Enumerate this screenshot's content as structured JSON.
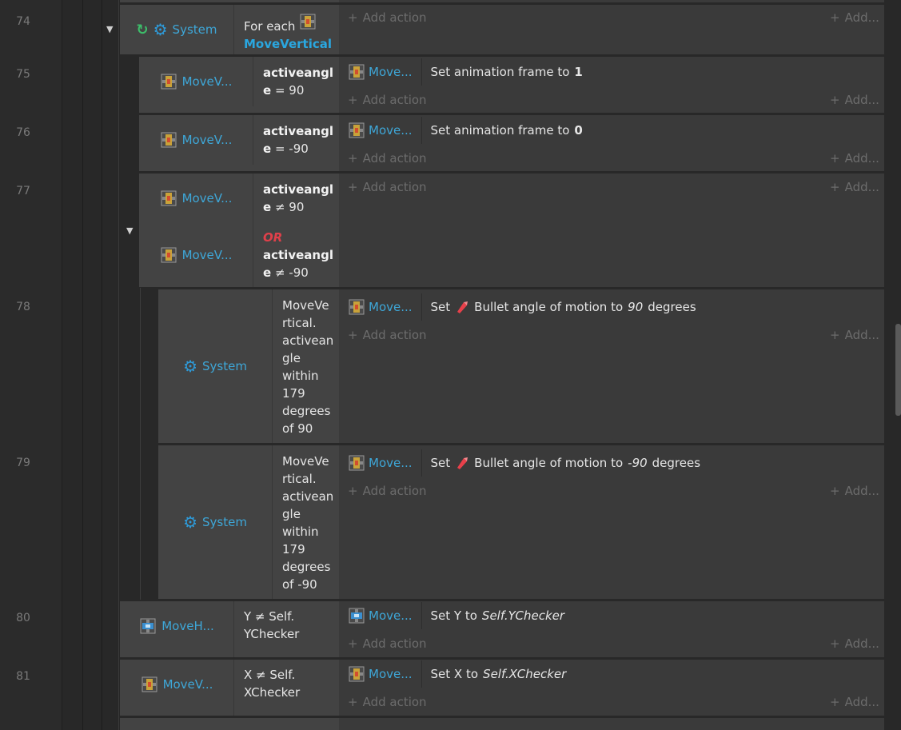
{
  "line_numbers": [
    "74",
    "75",
    "76",
    "77",
    "78",
    "79",
    "80",
    "81"
  ],
  "add_action": "Add action",
  "add_more": "Add...",
  "ev74": {
    "obj": "System",
    "c_pre": "For each",
    "c_obj": "MoveVertical"
  },
  "ev75": {
    "obj": "MoveV...",
    "c1": "activeangl",
    "c2": "e",
    "c3": " = 90",
    "a_obj": "Move...",
    "a_text": "Set animation frame to",
    "a_val": "1"
  },
  "ev76": {
    "obj": "MoveV...",
    "c1": "activeangl",
    "c2": "e",
    "c3": " = -90",
    "a_obj": "Move...",
    "a_text": "Set animation frame to",
    "a_val": "0"
  },
  "ev77": {
    "obj1": "MoveV...",
    "c1a": "activeangl",
    "c1b": "e",
    "c1c": " ≠ 90",
    "or": "OR",
    "obj2": "MoveV...",
    "c2a": "activeangl",
    "c2b": "e",
    "c2c": " ≠ -90"
  },
  "ev78": {
    "obj": "System",
    "lines": [
      "MoveVe",
      "rtical.",
      "activean",
      "gle",
      "within",
      "179",
      "degrees",
      "of 90"
    ],
    "a_obj": "Move...",
    "a_pre": "Set",
    "a_mid": "Bullet angle of motion to",
    "a_val": "90",
    "a_post": "degrees"
  },
  "ev79": {
    "obj": "System",
    "lines": [
      "MoveVe",
      "rtical.",
      "activean",
      "gle",
      "within",
      "179",
      "degrees",
      "of -90"
    ],
    "a_obj": "Move...",
    "a_pre": "Set",
    "a_mid": "Bullet angle of motion to",
    "a_val": "-90",
    "a_post": "degrees"
  },
  "ev80": {
    "obj": "MoveH...",
    "c1": "Y ≠ Self.",
    "c2": "YChecker",
    "a_obj": "Move...",
    "a_text": "Set Y to",
    "a_val": "Self.YChecker"
  },
  "ev81": {
    "obj": "MoveV...",
    "c1": "X ≠ Self.",
    "c2": "XChecker",
    "a_obj": "Move...",
    "a_text": "Set X to",
    "a_val": "Self.XChecker"
  },
  "colors": {
    "object_blue": "#3ea7d8",
    "or_red": "#e0404a",
    "loop_green": "#3dbd6a",
    "bullet_red": "#e8404a"
  },
  "icons": [
    "sprite-icon",
    "gear-icon",
    "loop-icon",
    "bullet-icon",
    "expand-triangle-icon",
    "plus-icon"
  ]
}
